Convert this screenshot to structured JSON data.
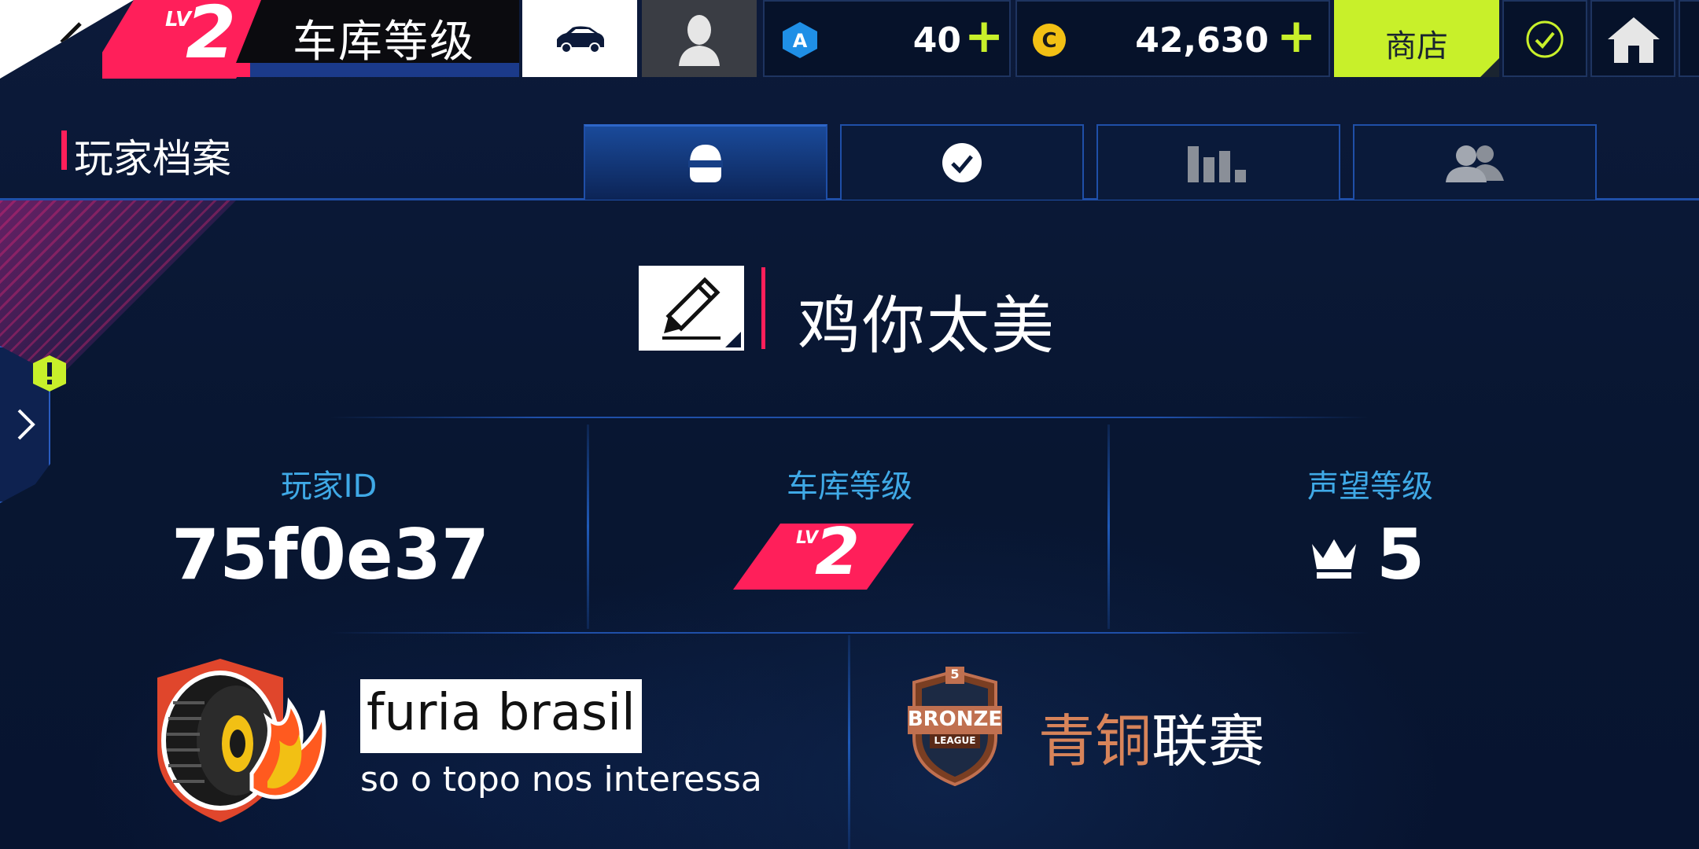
{
  "top_bar": {
    "level_prefix": "LV",
    "level_number": "2",
    "level_title": "车库等级",
    "xp_fraction": 0.05,
    "tokens": {
      "icon": "a-token-icon",
      "value": "40",
      "plus": "+"
    },
    "credits": {
      "icon": "c-coin-icon",
      "value": "42,630",
      "plus": "+"
    },
    "shop_label": "商店"
  },
  "header": {
    "title": "玩家档案",
    "tabs": [
      {
        "icon": "helmet-icon",
        "active": true
      },
      {
        "icon": "checkmark-icon",
        "active": false
      },
      {
        "icon": "bar-chart-icon",
        "active": false
      },
      {
        "icon": "friends-icon",
        "active": false
      }
    ]
  },
  "profile": {
    "player_name": "鸡你太美",
    "stats": [
      {
        "label": "玩家ID",
        "value": "75f0e37"
      },
      {
        "label": "车库等级",
        "badge_prefix": "LV",
        "badge_number": "2"
      },
      {
        "label": "声望等级",
        "value": "5",
        "icon": "crown-icon"
      }
    ],
    "crew": {
      "name": "furia brasil",
      "motto": "so o topo nos interessa",
      "emblem": "flaming-tire-icon"
    },
    "league": {
      "badge_top": "5",
      "badge_main": "BRONZE",
      "badge_sub": "LEAGUE",
      "name_part1": "青铜",
      "name_part2": "联赛"
    }
  },
  "colors": {
    "accent_pink": "#ff1f5a",
    "lime": "#c8f02a",
    "stat_label_blue": "#3fa9e6",
    "bronze": "#d8845a",
    "background": "#0a1836"
  }
}
